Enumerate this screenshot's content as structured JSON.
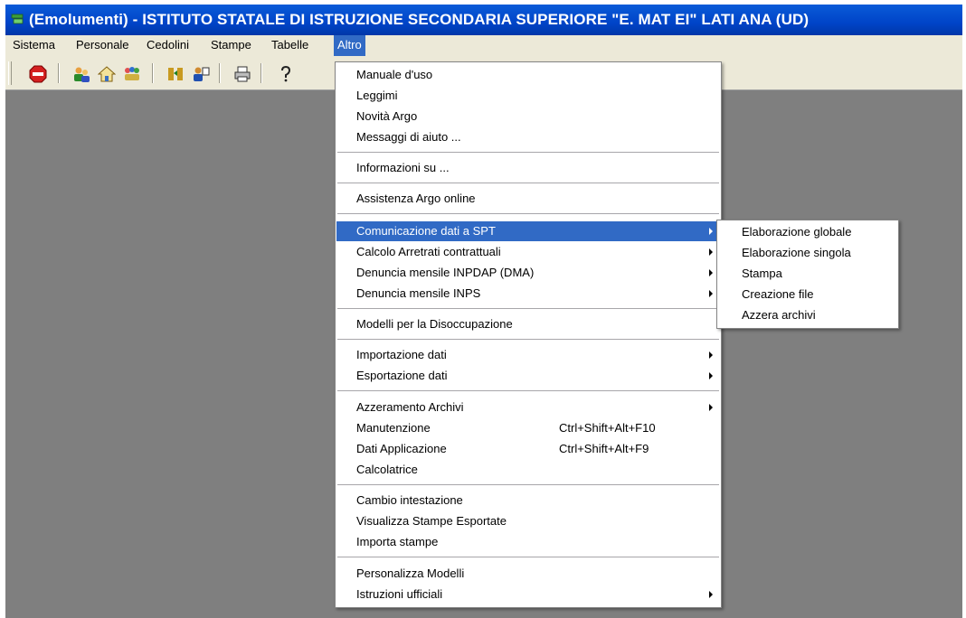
{
  "window": {
    "title": "(Emolumenti) - ISTITUTO STATALE DI ISTRUZIONE SECONDARIA SUPERIORE \"E. MAT  EI\" LATI ANA (UD)",
    "title_bar_color": "#0044c8",
    "background_color": "#7f7f7f",
    "app_icon": "argo-app-icon"
  },
  "menubar": {
    "items": [
      {
        "label": "Sistema"
      },
      {
        "label": "Personale"
      },
      {
        "label": "Cedolini"
      },
      {
        "label": "Stampe"
      },
      {
        "label": "Tabelle"
      },
      {
        "label": "Altro",
        "active": true
      }
    ],
    "highlight_color": "#316ac5"
  },
  "toolbar": {
    "buttons": [
      {
        "icon": "stop-icon"
      },
      {
        "icon": "people-icon"
      },
      {
        "icon": "house-icon"
      },
      {
        "icon": "group-icon"
      },
      {
        "icon": "transfer-icon"
      },
      {
        "icon": "users-config-icon"
      },
      {
        "icon": "printer-icon"
      },
      {
        "icon": "help-icon"
      }
    ]
  },
  "altro_menu": {
    "groups": [
      {
        "items": [
          {
            "label": "Manuale d'uso"
          },
          {
            "label": "Leggimi"
          },
          {
            "label": "Novità Argo"
          },
          {
            "label": "Messaggi di aiuto ..."
          }
        ]
      },
      {
        "items": [
          {
            "label": "Informazioni su ..."
          }
        ]
      },
      {
        "items": [
          {
            "label": "Assistenza Argo online"
          }
        ]
      },
      {
        "items": [
          {
            "label": "Comunicazione dati a SPT",
            "submenu": true,
            "highlighted": true
          },
          {
            "label": "Calcolo Arretrati contrattuali",
            "submenu": true
          },
          {
            "label": "Denuncia mensile INPDAP (DMA)",
            "submenu": true
          },
          {
            "label": "Denuncia mensile INPS",
            "submenu": true
          }
        ]
      },
      {
        "items": [
          {
            "label": "Modelli per la Disoccupazione"
          }
        ]
      },
      {
        "items": [
          {
            "label": "Importazione dati",
            "submenu": true
          },
          {
            "label": "Esportazione dati",
            "submenu": true
          }
        ]
      },
      {
        "items": [
          {
            "label": "Azzeramento Archivi",
            "submenu": true
          },
          {
            "label": "Manutenzione",
            "shortcut": "Ctrl+Shift+Alt+F10"
          },
          {
            "label": "Dati Applicazione",
            "shortcut": "Ctrl+Shift+Alt+F9"
          },
          {
            "label": "Calcolatrice"
          }
        ]
      },
      {
        "items": [
          {
            "label": "Cambio intestazione"
          },
          {
            "label": "Visualizza Stampe Esportate"
          },
          {
            "label": "Importa stampe"
          }
        ]
      },
      {
        "items": [
          {
            "label": "Personalizza Modelli"
          },
          {
            "label": "Istruzioni ufficiali",
            "submenu": true
          }
        ]
      }
    ]
  },
  "spt_submenu": {
    "items": [
      {
        "label": "Elaborazione globale"
      },
      {
        "label": "Elaborazione singola"
      },
      {
        "label": "Stampa"
      },
      {
        "label": "Creazione file"
      },
      {
        "label": "Azzera archivi"
      }
    ]
  }
}
